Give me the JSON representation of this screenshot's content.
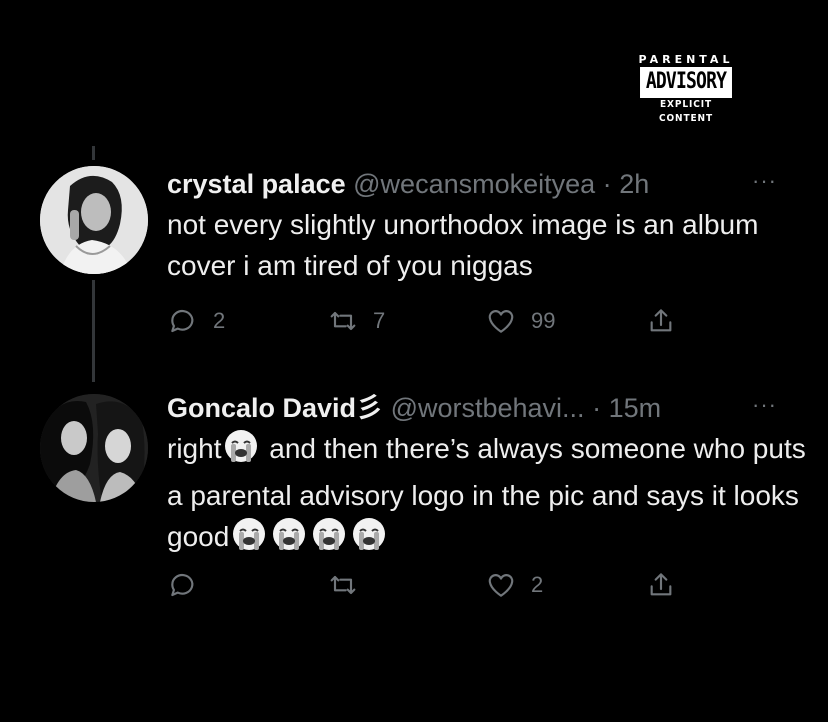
{
  "logo": {
    "top": "PARENTAL",
    "middle": "ADVISORY",
    "bottom": "EXPLICIT CONTENT"
  },
  "tweets": [
    {
      "name": "crystal palace",
      "handle": "@wecansmokeityea",
      "dot": "·",
      "time": "2h",
      "more": "···",
      "text": "not every slightly unorthodox image is an album cover i am tired of you niggas",
      "replies": "2",
      "retweets": "7",
      "likes": "99"
    },
    {
      "name": "Goncalo David",
      "name_suffix": "彡",
      "handle": "@worstbehavi...",
      "dot": "·",
      "time": "15m",
      "more": "···",
      "text_part1": "right",
      "text_part2": " and then there’s always someone who puts a parental advisory logo in the pic and says it looks good",
      "likes": "2"
    }
  ],
  "icons": {
    "reply": "reply-icon",
    "retweet": "retweet-icon",
    "like": "heart-icon",
    "share": "share-icon",
    "emoji": "loudly-crying-face-emoji"
  }
}
